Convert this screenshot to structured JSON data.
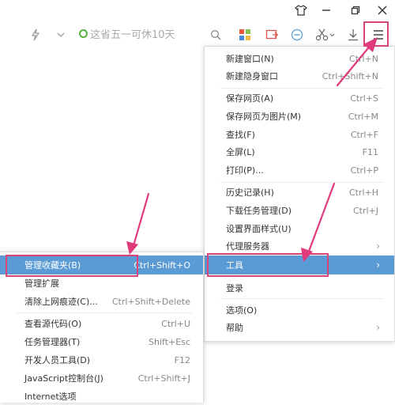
{
  "accent_color": "#5b9bd5",
  "annotation_color": "#e03a7c",
  "titlebar": {
    "icons": [
      "shirt-icon",
      "minimize-icon",
      "restore-icon",
      "close-icon"
    ],
    "glyphs": [
      "♡",
      "—",
      "❐",
      "✕"
    ]
  },
  "toolbar": {
    "search_hint": "这省五一可休10天",
    "icons": [
      "flash-icon",
      "chevron-down-icon",
      "search-icon",
      "apps-icon",
      "screenshot-icon",
      "minus-circle-icon",
      "scissors-icon",
      "download-icon",
      "menu-icon"
    ]
  },
  "main_menu": {
    "items": [
      {
        "label": "新建窗口(N)",
        "shortcut": "Ctrl+N"
      },
      {
        "label": "新建隐身窗口",
        "shortcut": "Ctrl+Shift+N"
      },
      {
        "label": "保存网页(A)",
        "shortcut": "Ctrl+S"
      },
      {
        "label": "保存网页为图片(M)",
        "shortcut": "Ctrl+M"
      },
      {
        "label": "查找(F)",
        "shortcut": "Ctrl+F"
      },
      {
        "label": "全屏(L)",
        "shortcut": "F11"
      },
      {
        "label": "打印(P)...",
        "shortcut": "Ctrl+P"
      },
      {
        "label": "历史记录(H)",
        "shortcut": "Ctrl+H"
      },
      {
        "label": "下载任务管理(D)",
        "shortcut": "Ctrl+J"
      },
      {
        "label": "设置界面样式(U)",
        "shortcut": ""
      },
      {
        "label": "代理服务器",
        "shortcut": ""
      },
      {
        "label": "工具",
        "shortcut": ""
      },
      {
        "label": "登录",
        "shortcut": ""
      },
      {
        "label": "选项(O)",
        "shortcut": ""
      },
      {
        "label": "帮助",
        "shortcut": ""
      }
    ]
  },
  "tools_submenu": {
    "items": [
      {
        "label": "管理收藏夹(B)",
        "shortcut": "Ctrl+Shift+O"
      },
      {
        "label": "管理扩展",
        "shortcut": ""
      },
      {
        "label": "清除上网痕迹(C)...",
        "shortcut": "Ctrl+Shift+Delete"
      },
      {
        "label": "查看源代码(O)",
        "shortcut": "Ctrl+U"
      },
      {
        "label": "任务管理器(T)",
        "shortcut": "Shift+Esc"
      },
      {
        "label": "开发人员工具(D)",
        "shortcut": "F12"
      },
      {
        "label": "JavaScript控制台(J)",
        "shortcut": "Ctrl+Shift+J"
      },
      {
        "label": "Internet选项",
        "shortcut": ""
      }
    ]
  }
}
